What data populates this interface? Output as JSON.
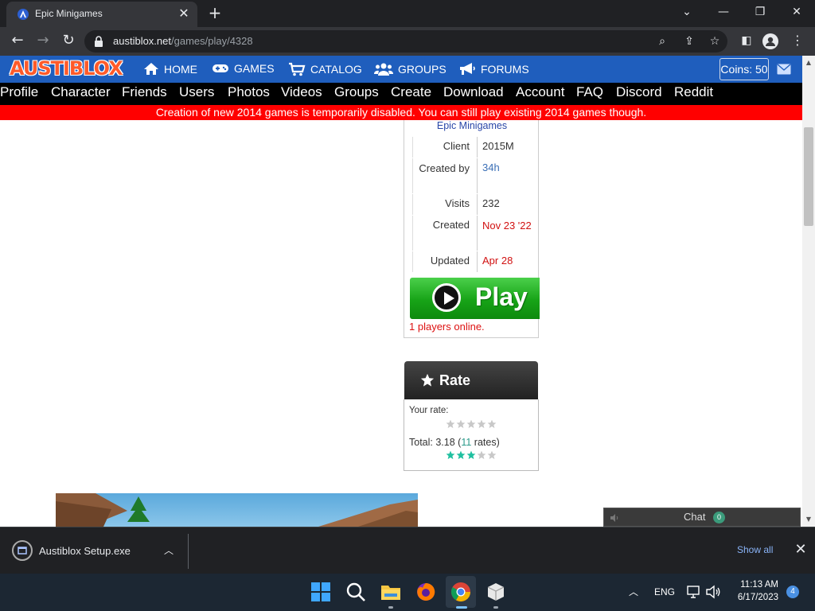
{
  "browser": {
    "tab_title": "Epic Minigames",
    "url_host": "austiblox.net",
    "url_path": "/games/play/4328"
  },
  "site": {
    "logo_text": "AUSTIBLOX",
    "top_nav": [
      {
        "label": "HOME",
        "icon": "home-icon"
      },
      {
        "label": "GAMES",
        "icon": "gamepad-icon"
      },
      {
        "label": "CATALOG",
        "icon": "cart-icon"
      },
      {
        "label": "GROUPS",
        "icon": "users-icon"
      },
      {
        "label": "FORUMS",
        "icon": "bullhorn-icon"
      }
    ],
    "coins_label": "Coins: 50",
    "sub_nav": [
      "Profile",
      "Character",
      "Friends",
      "Users",
      "Photos",
      "Videos",
      "Groups",
      "Create",
      "Download",
      "Account",
      "FAQ",
      "Discord",
      "Reddit"
    ],
    "notice": "Creation of new 2014 games is temporarily disabled. You can still play existing 2014 games though.",
    "brand_color": "#1f5ebd",
    "notice_color": "#ff0000"
  },
  "game": {
    "title": "Epic Minigames",
    "info": [
      {
        "label": "Client",
        "value": "2015M",
        "color": "#333333"
      },
      {
        "label": "Created by",
        "value": "34h",
        "color": "#3b6fb6"
      },
      {
        "label": "Visits",
        "value": "232",
        "color": "#333333"
      },
      {
        "label": "Created",
        "value": "Nov 23 '22",
        "color": "#d11111"
      },
      {
        "label": "Updated",
        "value": "Apr 28",
        "color": "#d11111"
      }
    ],
    "play_label": "Play",
    "players_online": "1 players online."
  },
  "rating": {
    "header": "Rate",
    "your_rate_label": "Your rate:",
    "your_rate_stars": 0,
    "total_prefix": "Total: ",
    "total_score": "3.18",
    "total_open": " (",
    "total_count": "11",
    "total_suffix": " rates)",
    "total_stars_filled": 3,
    "star_filled_color": "#20c0a0",
    "star_empty_color": "#c8c8c8"
  },
  "chat": {
    "label": "Chat",
    "unread": "0"
  },
  "downloads": {
    "file_name": "Austiblox Setup.exe",
    "show_all": "Show all"
  },
  "taskbar": {
    "language": "ENG",
    "time": "11:13 AM",
    "date": "6/17/2023",
    "notifications": "4"
  }
}
